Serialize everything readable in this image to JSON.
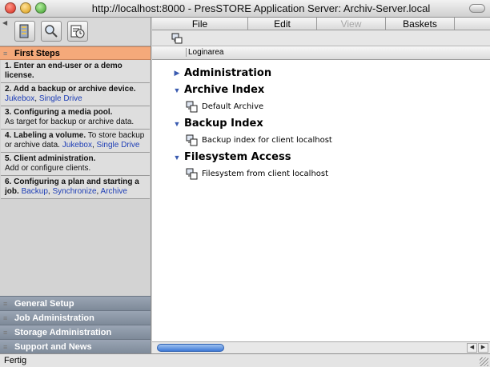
{
  "window": {
    "title": "http://localhost:8000 - PresSTORE Application Server: Archiv-Server.local"
  },
  "toolbar": {
    "buttons": [
      {
        "icon": "server-icon"
      },
      {
        "icon": "magnifier-icon"
      },
      {
        "icon": "scheduler-icon"
      }
    ]
  },
  "sidebar": {
    "first_steps": {
      "title": "First Steps",
      "steps": [
        {
          "bold": "1. Enter an end-user or a demo license.",
          "text": "",
          "links": []
        },
        {
          "bold": "2. Add a backup or archive device.",
          "text": "",
          "links": [
            "Jukebox",
            "Single Drive"
          ]
        },
        {
          "bold": "3. Configuring a media pool.",
          "text": "As target for backup or archive data.",
          "links": []
        },
        {
          "bold": "4. Labeling a volume.",
          "text": "To store backup or archive data.",
          "links": [
            "Jukebox",
            "Single Drive"
          ]
        },
        {
          "bold": "5. Client administration.",
          "text": "Add or configure clients.",
          "links": []
        },
        {
          "bold": "6. Configuring a plan and starting a job.",
          "text": "",
          "links": [
            "Backup",
            "Synchronize",
            "Archive"
          ]
        }
      ]
    },
    "sections": [
      "General Setup",
      "Job Administration",
      "Storage Administration",
      "Support and News"
    ]
  },
  "menubar": {
    "items": [
      {
        "label": "File",
        "enabled": true
      },
      {
        "label": "Edit",
        "enabled": true
      },
      {
        "label": "View",
        "enabled": false
      },
      {
        "label": "Baskets",
        "enabled": true
      }
    ]
  },
  "column_header": "Loginarea",
  "tree": [
    {
      "label": "Administration",
      "expanded": false,
      "children": []
    },
    {
      "label": "Archive Index",
      "expanded": true,
      "children": [
        "Default Archive"
      ]
    },
    {
      "label": "Backup Index",
      "expanded": true,
      "children": [
        "Backup index for client localhost"
      ]
    },
    {
      "label": "Filesystem Access",
      "expanded": true,
      "children": [
        "Filesystem from client localhost"
      ]
    }
  ],
  "status": {
    "text": "Fertig"
  },
  "colors": {
    "accent_active_section": "#f5a97a",
    "link": "#1f3fb6",
    "collapsed_section": "#8a95a4"
  }
}
